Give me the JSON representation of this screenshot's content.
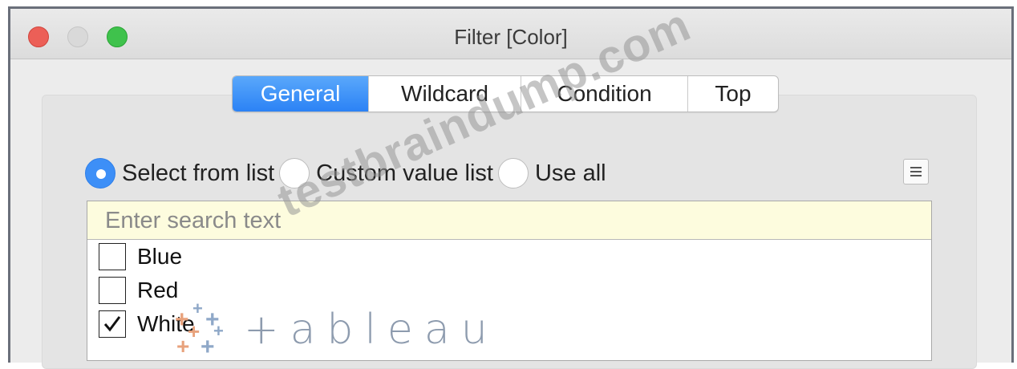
{
  "window": {
    "title": "Filter [Color]"
  },
  "tabs": [
    "General",
    "Wildcard",
    "Condition",
    "Top"
  ],
  "radio_options": [
    "Select from list",
    "Custom value list",
    "Use all"
  ],
  "search": {
    "placeholder": "Enter search text"
  },
  "items": [
    {
      "label": "Blue",
      "checked": false
    },
    {
      "label": "Red",
      "checked": false
    },
    {
      "label": "White",
      "checked": true
    }
  ],
  "logo": {
    "wordmark": "+ableau"
  },
  "watermark": "testbraindump.com",
  "colors": {
    "accent": "#3d8ff7",
    "search_bg": "#fdfcde",
    "close": "#ec5f57",
    "maximize": "#3fc24c"
  }
}
